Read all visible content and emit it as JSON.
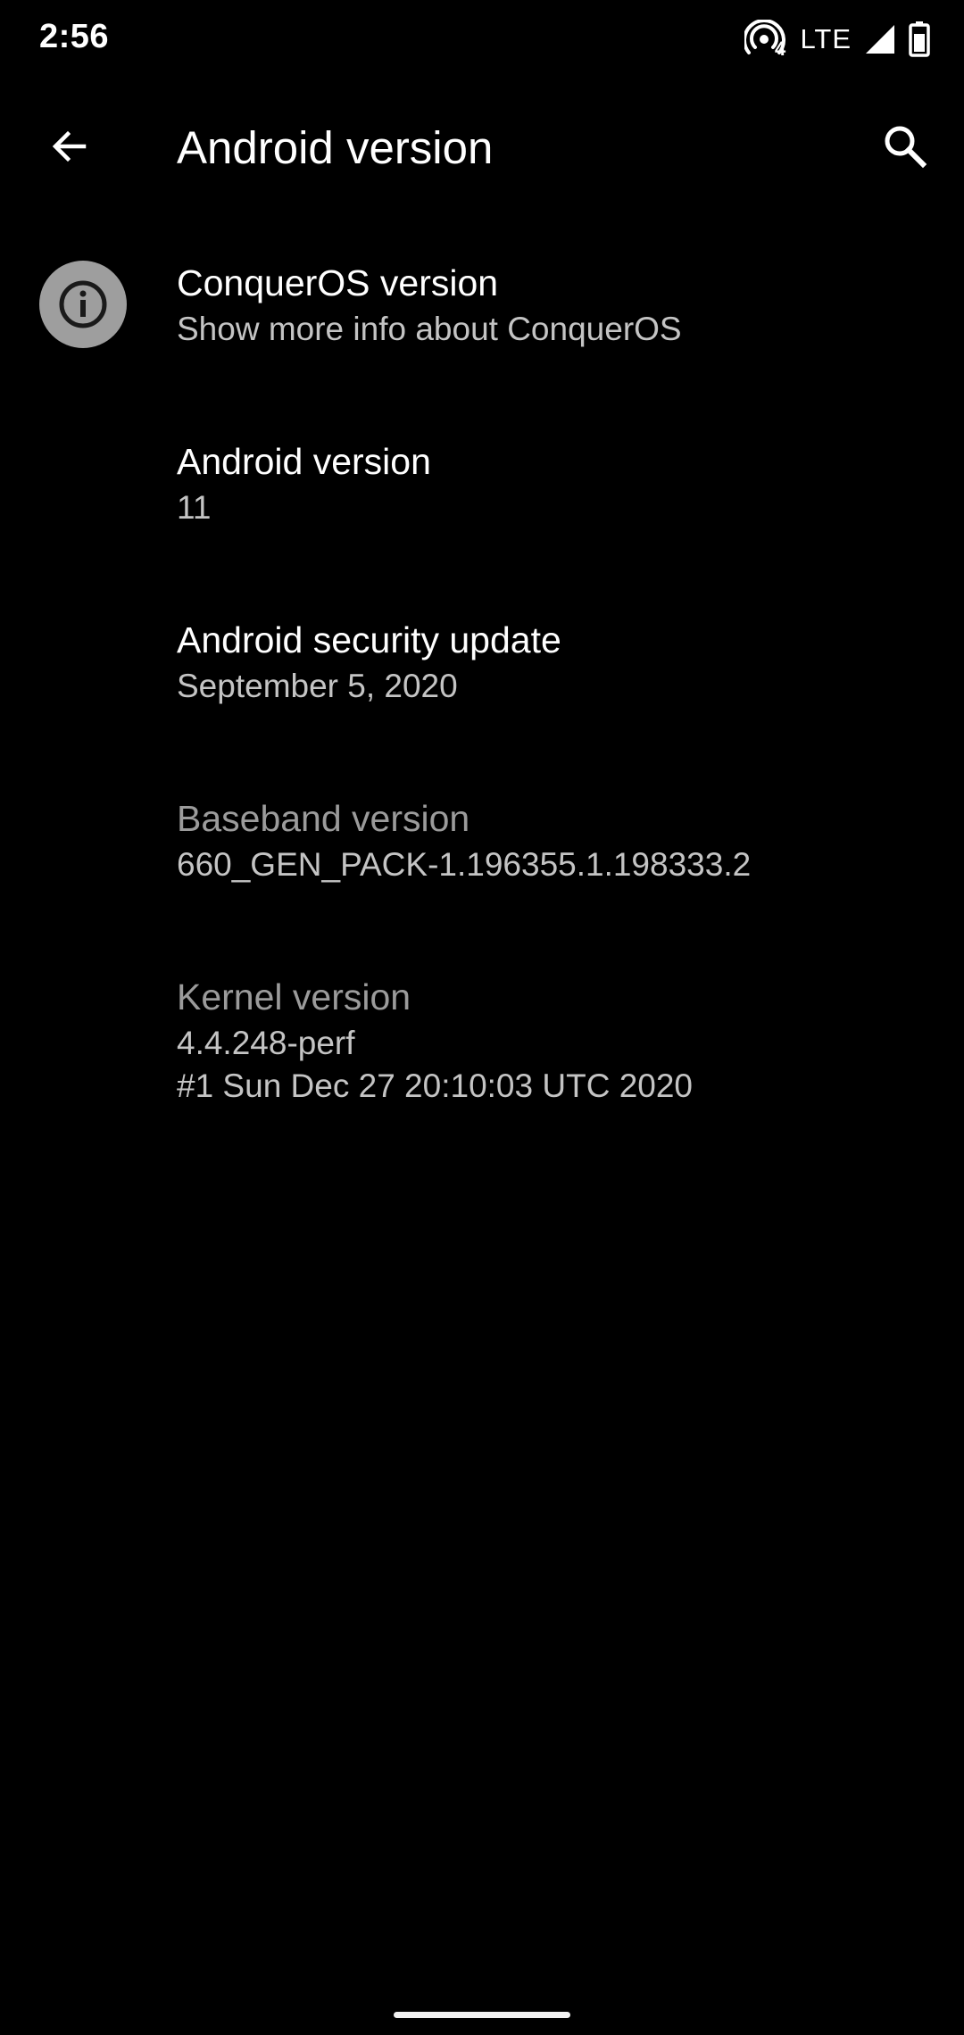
{
  "status_bar": {
    "time": "2:56",
    "hotspot_count": "4",
    "network": "LTE",
    "icons": [
      "hotspot-icon",
      "signal-icon",
      "battery-icon"
    ]
  },
  "app_bar": {
    "title": "Android version",
    "back_icon": "arrow-back-icon",
    "search_icon": "search-icon"
  },
  "items": [
    {
      "title": "ConquerOS version",
      "summary": "Show more info about ConquerOS",
      "icon": "info-icon",
      "enabled": true
    },
    {
      "title": "Android version",
      "summary": "11",
      "enabled": true
    },
    {
      "title": "Android security update",
      "summary": "September 5, 2020",
      "enabled": true
    },
    {
      "title": "Baseband version",
      "summary": "660_GEN_PACK-1.196355.1.198333.2",
      "enabled": false
    },
    {
      "title": "Kernel version",
      "summary_lines": [
        "4.4.248-perf",
        "#1 Sun Dec 27 20:10:03 UTC 2020"
      ],
      "enabled": false
    }
  ],
  "colors": {
    "background": "#000000",
    "primary_text": "#ffffff",
    "secondary_text": "#c4c4c4",
    "disabled_text": "#9b9b9b",
    "icon_background": "#9e9e9e"
  }
}
